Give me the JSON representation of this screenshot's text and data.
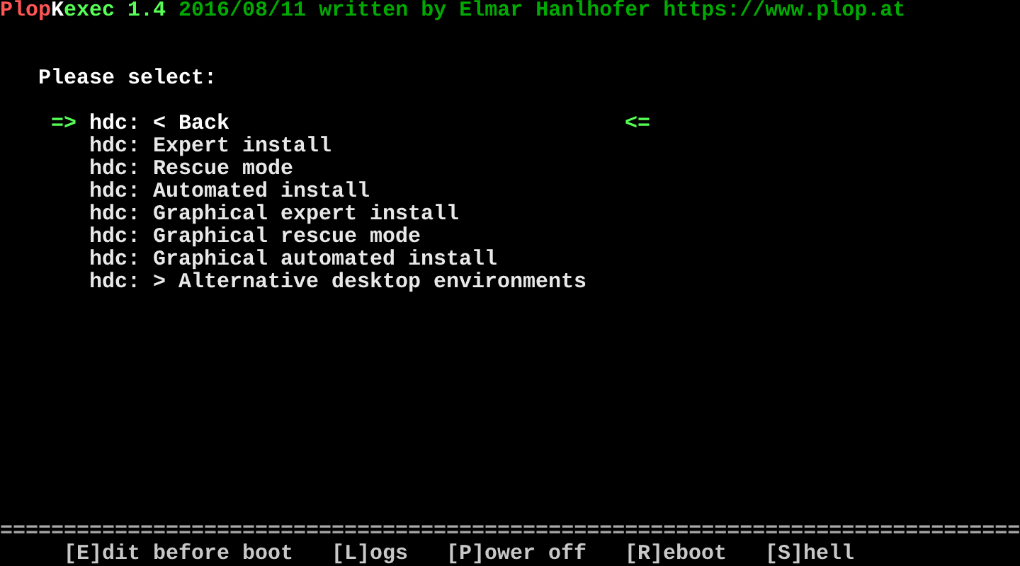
{
  "header": {
    "segments": [
      {
        "text": "Plop",
        "color": "#ff5555"
      },
      {
        "text": "K",
        "color": "#ffffff"
      },
      {
        "text": "exec 1.4",
        "color": "#55ff55"
      },
      {
        "text": " 2016/08/11 written by Elmar Hanlhofer https://www.plop.at",
        "color": "#00aa00"
      }
    ]
  },
  "prompt": "Please select:",
  "menu": {
    "marker_left": "=>",
    "marker_right": "<=",
    "items": [
      {
        "label": "hdc: < Back",
        "selected": true
      },
      {
        "label": "hdc: Expert install",
        "selected": false
      },
      {
        "label": "hdc: Rescue mode",
        "selected": false
      },
      {
        "label": "hdc: Automated install",
        "selected": false
      },
      {
        "label": "hdc: Graphical expert install",
        "selected": false
      },
      {
        "label": "hdc: Graphical rescue mode",
        "selected": false
      },
      {
        "label": "hdc: Graphical automated install",
        "selected": false
      },
      {
        "label": "hdc: > Alternative desktop environments",
        "selected": false
      }
    ]
  },
  "separator": "================================================================================",
  "footer": [
    "[E]dit before boot",
    "[L]ogs",
    "[P]ower off",
    "[R]eboot",
    "[S]hell"
  ]
}
